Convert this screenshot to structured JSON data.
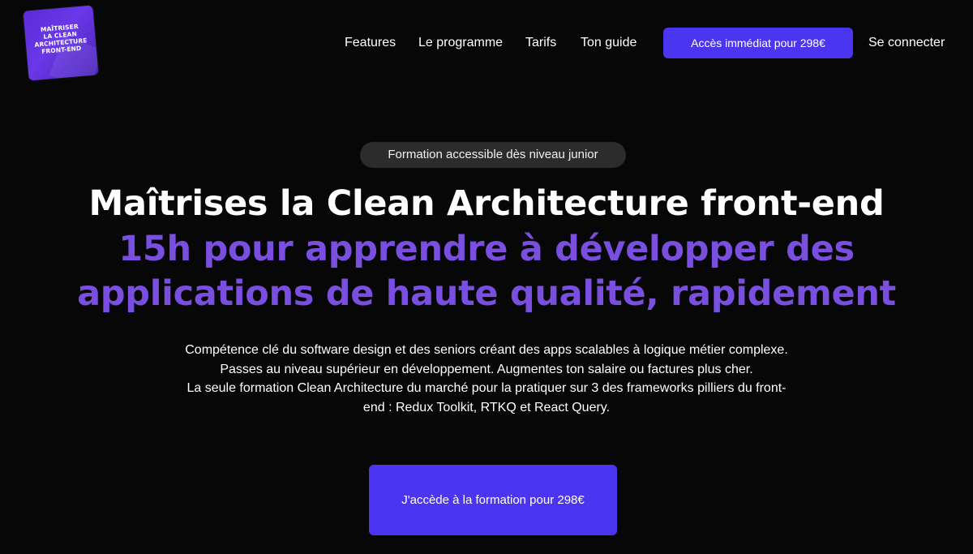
{
  "logo": {
    "text": "MAÎTRISER\nLA CLEAN\nARCHITECTURE\nFRONT-END"
  },
  "nav": {
    "features": "Features",
    "programme": "Le programme",
    "tarifs": "Tarifs",
    "guide": "Ton guide",
    "cta": "Accès immédiat pour 298€",
    "login": "Se connecter"
  },
  "hero": {
    "badge": "Formation accessible dès niveau junior",
    "title": "Maîtrises la Clean Architecture front-end",
    "subtitle_lines": [
      "15h pour apprendre à développer des",
      "applications de haute qualité, rapidement"
    ],
    "description_lines": [
      "Compétence clé du software design et des seniors créant des apps scalables à logique métier complexe.",
      "Passes au niveau supérieur en développement. Augmentes ton salaire ou factures plus cher.",
      "La seule formation Clean Architecture du marché pour la pratiquer sur 3 des frameworks pilliers du front-",
      "end : Redux Toolkit, RTKQ et React Query."
    ],
    "cta": "J'accède à la formation pour 298€"
  },
  "colors": {
    "background": "#070707",
    "accent": "#4a36f0",
    "subtitle": "#7a4fe0",
    "badge_bg": "#2c2c2c"
  }
}
